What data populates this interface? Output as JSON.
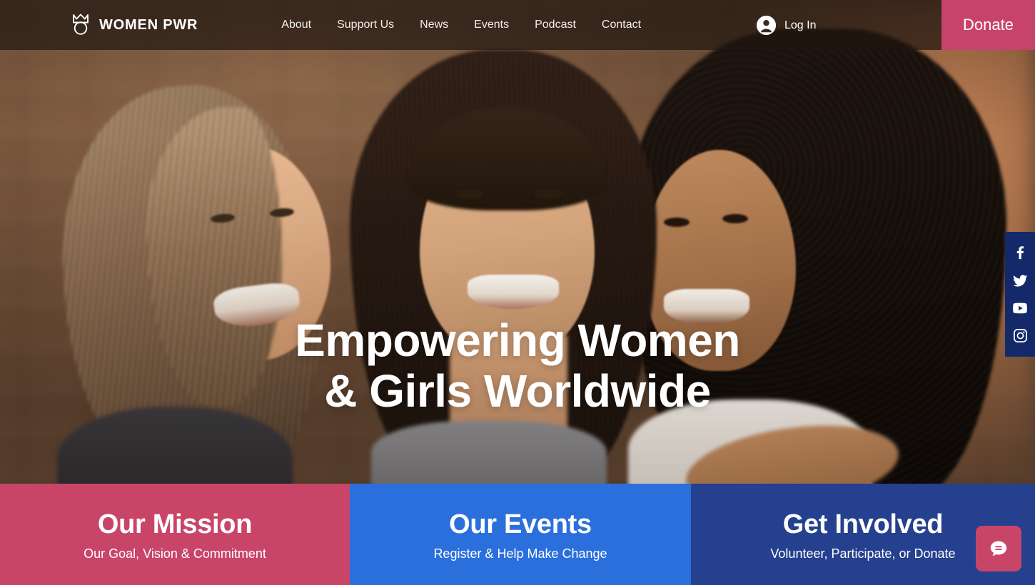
{
  "site": {
    "brand_name": "WOMEN PWR",
    "brand_icon": "tulip-crown-logo"
  },
  "header": {
    "nav_items": [
      {
        "label": "About"
      },
      {
        "label": "Support Us"
      },
      {
        "label": "News"
      },
      {
        "label": "Events"
      },
      {
        "label": "Podcast"
      },
      {
        "label": "Contact"
      }
    ],
    "account": {
      "label": "Log In",
      "icon": "user-avatar-icon"
    },
    "donate_label": "Donate",
    "donate_color": "#c8436c",
    "background": "rgba(32,22,16,0.70)"
  },
  "hero": {
    "headline_line1": "Empowering Women",
    "headline_line2": "& Girls Worldwide",
    "text_color": "#ffffff",
    "image_alt": "Three smiling women embracing in front of a brick wall"
  },
  "social": {
    "background": "#14296a",
    "items": [
      {
        "name": "facebook",
        "icon": "facebook-icon"
      },
      {
        "name": "twitter",
        "icon": "twitter-icon"
      },
      {
        "name": "youtube",
        "icon": "youtube-icon"
      },
      {
        "name": "instagram",
        "icon": "instagram-icon"
      }
    ]
  },
  "cards": [
    {
      "title": "Our Mission",
      "subtitle": "Our Goal, Vision & Commitment",
      "color": "#c94568"
    },
    {
      "title": "Our Events",
      "subtitle": "Register & Help Make Change",
      "color": "#2b6fdd"
    },
    {
      "title": "Get Involved",
      "subtitle": "Volunteer, Participate, or Donate",
      "color": "#25408e"
    }
  ],
  "chat_widget": {
    "icon": "chat-bubble-icon",
    "color": "#c94568"
  }
}
